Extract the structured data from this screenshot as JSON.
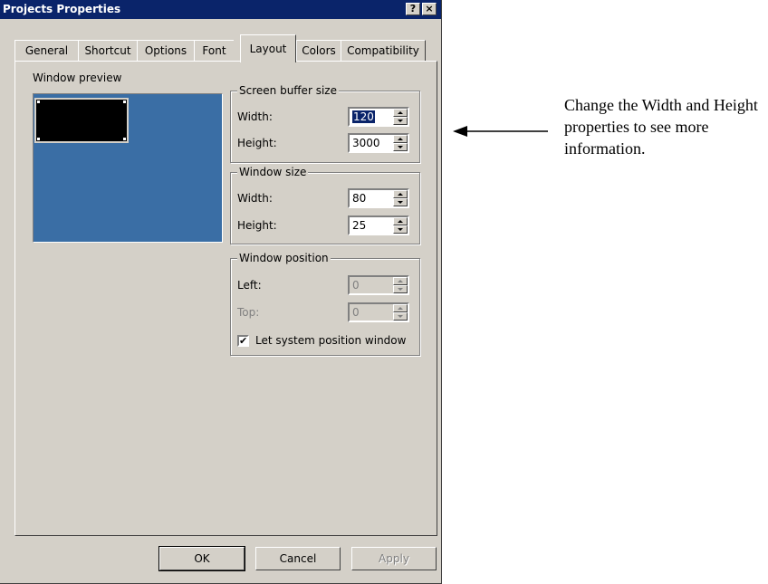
{
  "window": {
    "title": "Projects Properties",
    "help_btn": "?",
    "close_btn": "×"
  },
  "tabs": [
    {
      "label": "General",
      "active": false
    },
    {
      "label": "Shortcut",
      "active": false
    },
    {
      "label": "Options",
      "active": false
    },
    {
      "label": "Font",
      "active": false
    },
    {
      "label": "Layout",
      "active": true
    },
    {
      "label": "Colors",
      "active": false
    },
    {
      "label": "Compatibility",
      "active": false
    }
  ],
  "preview": {
    "label": "Window preview"
  },
  "screen_buffer": {
    "legend": "Screen buffer size",
    "width_label": "Width:",
    "width_value": "120",
    "height_label": "Height:",
    "height_value": "3000"
  },
  "window_size": {
    "legend": "Window size",
    "width_label": "Width:",
    "width_value": "80",
    "height_label": "Height:",
    "height_value": "25"
  },
  "window_position": {
    "legend": "Window position",
    "left_label": "Left:",
    "left_value": "0",
    "top_label": "Top:",
    "top_value": "0",
    "checkbox_label": "Let system position window",
    "checkbox_checked": true
  },
  "buttons": {
    "ok": "OK",
    "cancel": "Cancel",
    "apply": "Apply"
  },
  "annotation": {
    "text": "Change the Width and Height properties to see more information."
  },
  "icons": {
    "help": "question-mark-icon",
    "close": "close-icon",
    "arrow": "left-arrow-icon",
    "check": "checkmark-icon"
  },
  "colors": {
    "titlebar": "#0a246a",
    "dialog_bg": "#d4d0c8",
    "preview_bg": "#3a6ea5",
    "selection": "#0a246a"
  }
}
